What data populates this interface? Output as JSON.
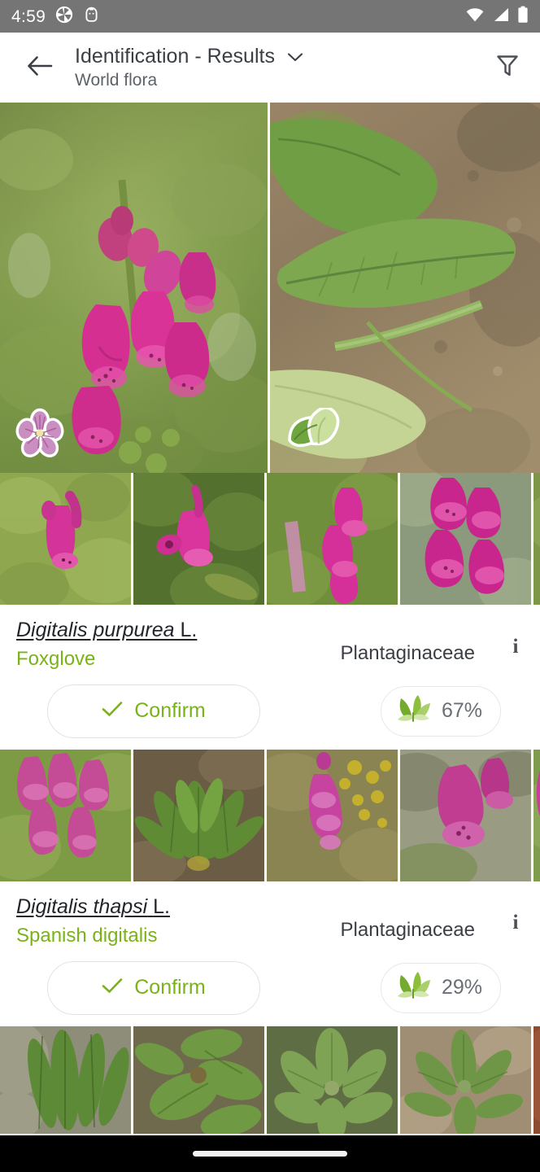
{
  "status_bar": {
    "time": "4:59",
    "left_icons": [
      "camera-shutter-icon",
      "android-face-icon"
    ],
    "right_icons": [
      "wifi-icon",
      "cellular-signal-icon",
      "battery-icon"
    ],
    "background": "#757575",
    "foreground": "#ffffff"
  },
  "app_bar": {
    "back_icon": "back-arrow-icon",
    "title": "Identification - Results",
    "subtitle": "World flora",
    "dropdown_icon": "chevron-down-icon",
    "filter_icon": "filter-funnel-icon"
  },
  "query_images": [
    {
      "organ": "flower",
      "badge_icon": "flower-organ-icon"
    },
    {
      "organ": "leaf",
      "badge_icon": "leaf-organ-icon"
    }
  ],
  "theme": {
    "accent_green": "#7ab317",
    "leaf_dark": "#6fa824",
    "leaf_light": "#cfe3a8",
    "text_primary": "#22262b",
    "text_secondary": "#5d6268",
    "border": "#e2e3e4"
  },
  "results": [
    {
      "scientific_name": "Digitalis purpurea",
      "author": "L.",
      "common_name": "Foxglove",
      "family": "Plantaginaceae",
      "score": "67%",
      "confirm_label": "Confirm",
      "confirm_icon": "check-icon",
      "info_icon": "i",
      "score_icon": "leaf-sprig-icon",
      "thumbnails": 5
    },
    {
      "scientific_name": "Digitalis thapsi",
      "author": "L.",
      "common_name": "Spanish digitalis",
      "family": "Plantaginaceae",
      "score": "29%",
      "confirm_label": "Confirm",
      "confirm_icon": "check-icon",
      "info_icon": "i",
      "score_icon": "leaf-sprig-icon",
      "thumbnails": 5
    },
    {
      "scientific_name": "",
      "author": "",
      "common_name": "",
      "family": "",
      "score": "",
      "confirm_label": "",
      "thumbnails": 5
    }
  ],
  "nav_bar": {
    "handle": "gesture-home-handle"
  }
}
